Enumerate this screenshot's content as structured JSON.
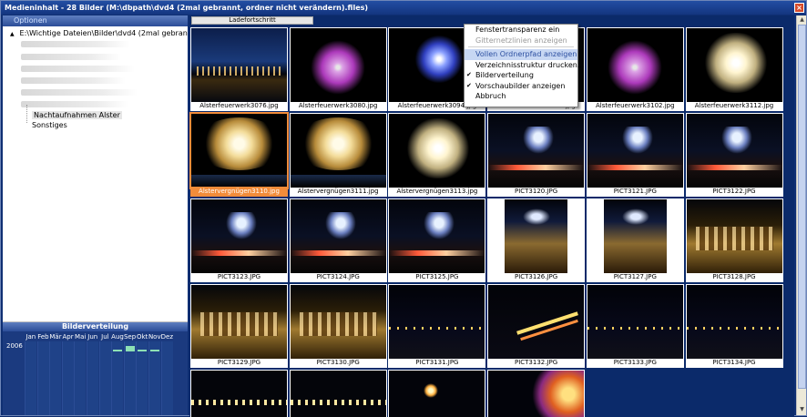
{
  "window": {
    "title": "Medieninhalt - 28 Bilder (M:\\dbpath\\dvd4 (2mal gebrannt, ordner nicht verändern).files)",
    "close_label": "×"
  },
  "left_panel": {
    "options_label": "Optionen",
    "tree": {
      "root_label": "E:\\Wichtige Dateien\\Bilder\\dvd4 (2mal gebrannt, ordner",
      "twisty": "▲",
      "children": [
        "Nachtaufnahmen Alster",
        "Sonstiges"
      ]
    },
    "distribution": {
      "title": "Bilderverteilung",
      "months": [
        "Jan",
        "Feb",
        "Mär",
        "Apr",
        "Mai",
        "Jun",
        "Jul",
        "Aug",
        "Sep",
        "Okt",
        "Nov",
        "Dez"
      ],
      "year": "2006",
      "bar_color": "#8de0b4"
    }
  },
  "grid": {
    "progress_label": "Ladefortschritt",
    "thumbnails": [
      {
        "label": "Alsterfeuerwerk3076.jpg",
        "scene": "city"
      },
      {
        "label": "Alsterfeuerwerk3080.jpg",
        "scene": "fireworks-pink"
      },
      {
        "label": "Alsterfeuerwerk3094.jpg",
        "scene": "fireworks-blue"
      },
      {
        "label": "Alsterfeuerwerk3100.jpg",
        "scene": "fireworks-dark"
      },
      {
        "label": "Alsterfeuerwerk3102.jpg",
        "scene": "fireworks-pink"
      },
      {
        "label": "Alsterfeuerwerk3112.jpg",
        "scene": "fireworks-white"
      },
      {
        "label": "Alstervergnügen3110.jpg",
        "scene": "fireworks-gold",
        "selected": true
      },
      {
        "label": "Alstervergnügen3111.jpg",
        "scene": "fireworks-gold"
      },
      {
        "label": "Alstervergnügen3113.jpg",
        "scene": "fireworks-white"
      },
      {
        "label": "PICT3120.JPG",
        "scene": "hotel-street"
      },
      {
        "label": "PICT3121.JPG",
        "scene": "hotel-street"
      },
      {
        "label": "PICT3122.JPG",
        "scene": "hotel-street"
      },
      {
        "label": "PICT3123.JPG",
        "scene": "hotel-street"
      },
      {
        "label": "PICT3124.JPG",
        "scene": "hotel-street"
      },
      {
        "label": "PICT3125.JPG",
        "scene": "hotel-street"
      },
      {
        "label": "PICT3126.JPG",
        "scene": "hotel-portrait"
      },
      {
        "label": "PICT3127.JPG",
        "scene": "hotel-portrait"
      },
      {
        "label": "PICT3128.JPG",
        "scene": "building-gold"
      },
      {
        "label": "PICT3129.JPG",
        "scene": "building-gold"
      },
      {
        "label": "PICT3130.JPG",
        "scene": "building-gold"
      },
      {
        "label": "PICT3131.JPG",
        "scene": "night-road"
      },
      {
        "label": "PICT3132.JPG",
        "scene": "night-road-streaks"
      },
      {
        "label": "PICT3133.JPG",
        "scene": "night-road"
      },
      {
        "label": "PICT3134.JPG",
        "scene": "night-road"
      },
      {
        "label": "",
        "scene": "dark-lights",
        "partial": true
      },
      {
        "label": "",
        "scene": "dark-lights",
        "partial": true
      },
      {
        "label": "",
        "scene": "dark-lamp",
        "partial": true
      },
      {
        "label": "",
        "scene": "orange-glow",
        "partial": true
      }
    ]
  },
  "context_menu": {
    "items": [
      {
        "label": "Fenstertransparenz ein",
        "state": "normal",
        "checked": false
      },
      {
        "label": "Gitternetzlinien anzeigen",
        "state": "disabled",
        "checked": false
      },
      {
        "label": "Vollen Ordnerpfad anzeigen",
        "state": "highlight",
        "checked": false
      },
      {
        "label": "Verzeichnisstruktur drucken...",
        "state": "normal",
        "checked": false
      },
      {
        "label": "Bilderverteilung",
        "state": "normal",
        "checked": true
      },
      {
        "label": "Vorschaubilder anzeigen",
        "state": "normal",
        "checked": true
      },
      {
        "label": "Abbruch",
        "state": "normal",
        "checked": false
      }
    ],
    "check_glyph": "✔"
  },
  "scroll": {
    "up": "▲",
    "down": "▼",
    "left": "◄",
    "right": "►"
  }
}
